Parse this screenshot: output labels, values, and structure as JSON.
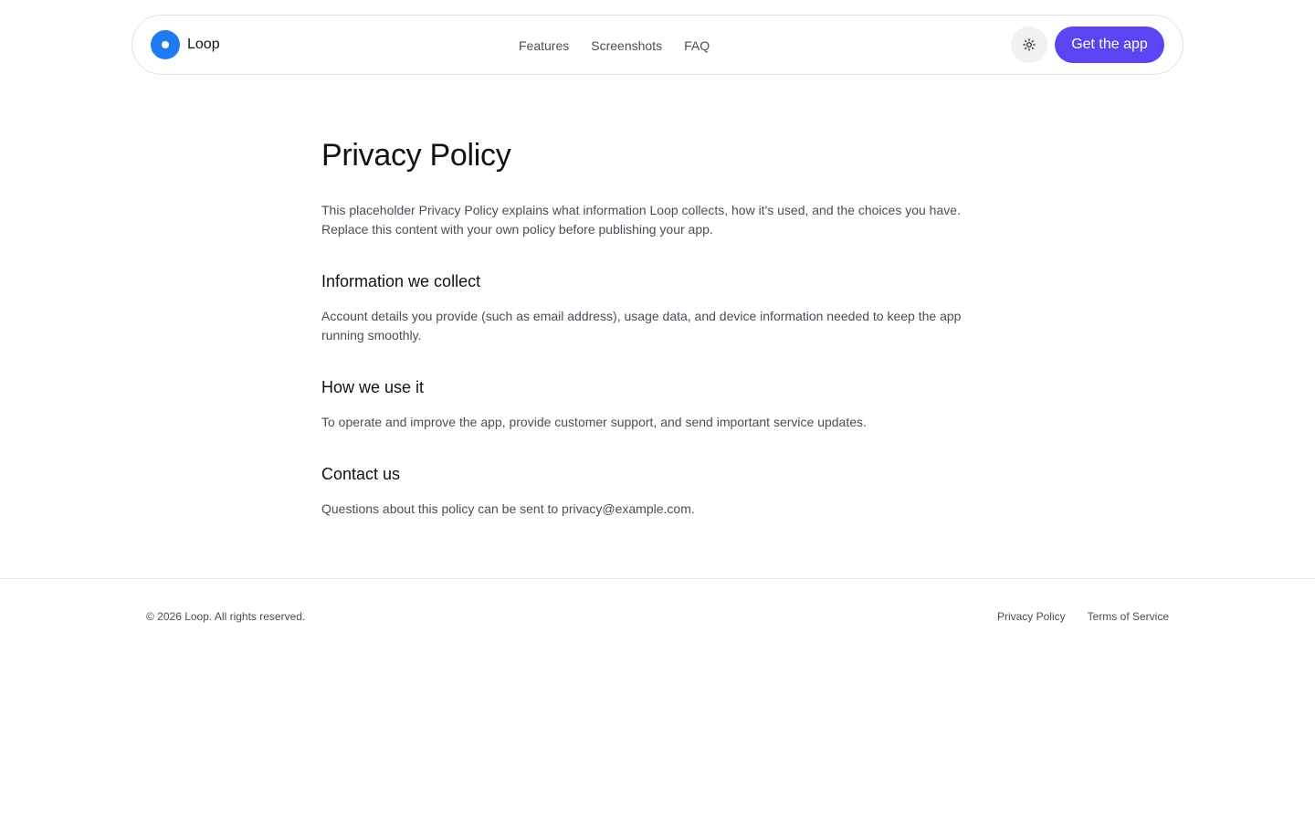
{
  "header": {
    "brand_name": "Loop",
    "nav": [
      {
        "label": "Features"
      },
      {
        "label": "Screenshots"
      },
      {
        "label": "FAQ"
      }
    ],
    "theme_toggle_icon": "sun-icon",
    "cta_label": "Get the app",
    "colors": {
      "logo": "#1f7cf0",
      "cta": "#5b44f2"
    }
  },
  "article": {
    "title": "Privacy Policy",
    "intro": "This placeholder Privacy Policy explains what information Loop collects, how it's used, and the choices you have. Replace this content with your own policy before publishing your app.",
    "sections": [
      {
        "heading": "Information we collect",
        "body": "Account details you provide (such as email address), usage data, and device information needed to keep the app running smoothly."
      },
      {
        "heading": "How we use it",
        "body": "To operate and improve the app, provide customer support, and send important service updates."
      },
      {
        "heading": "Contact us",
        "body": "Questions about this policy can be sent to privacy@example.com."
      }
    ]
  },
  "footer": {
    "copyright": "© 2026 Loop. All rights reserved.",
    "links": [
      {
        "label": "Privacy Policy"
      },
      {
        "label": "Terms of Service"
      }
    ]
  }
}
